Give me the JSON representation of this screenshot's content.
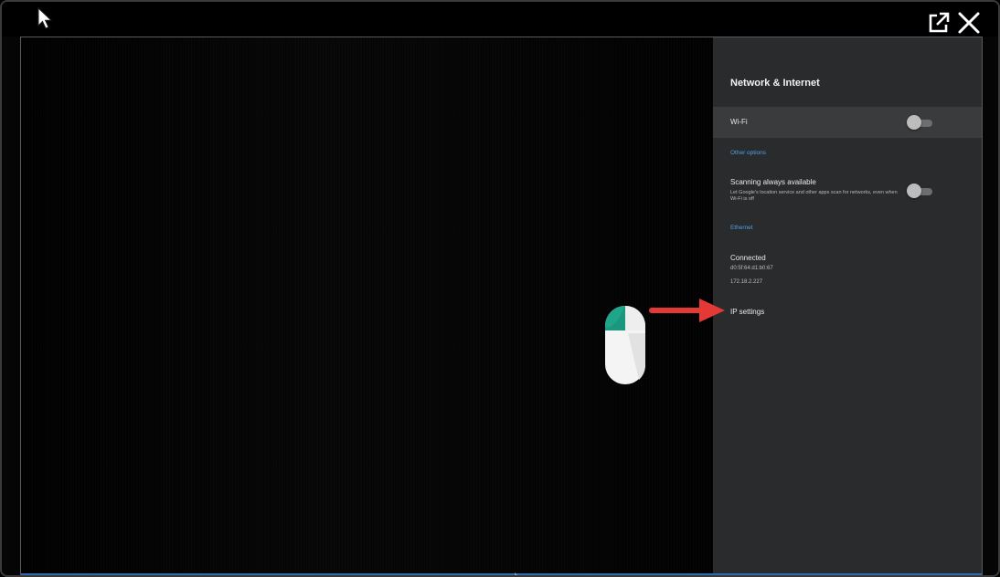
{
  "panel": {
    "title": "Network & Internet",
    "wifi": {
      "label": "Wi-Fi",
      "enabled": false
    },
    "other_options_header": "Other options",
    "scanning": {
      "title": "Scanning always available",
      "description": "Let Google's location service and other apps scan for networks, even when Wi-Fi is off",
      "enabled": false
    },
    "ethernet_header": "Ethernet",
    "connection": {
      "status": "Connected",
      "mac": "d0:5f:64:d1:b0:67",
      "ip": "172.18.2.227"
    },
    "ip_settings_label": "IP settings"
  },
  "colors": {
    "accent": "#4ea1e6",
    "panel_background": "#2a2b2d",
    "highlight_row": "#3a3b3d",
    "annotation_arrow": "#e53935",
    "mouse_button": "#1fa58a"
  },
  "icons": {
    "popout": "external-link-icon",
    "close": "close-icon",
    "cursor": "cursor-icon",
    "mouse": "mouse-icon"
  }
}
